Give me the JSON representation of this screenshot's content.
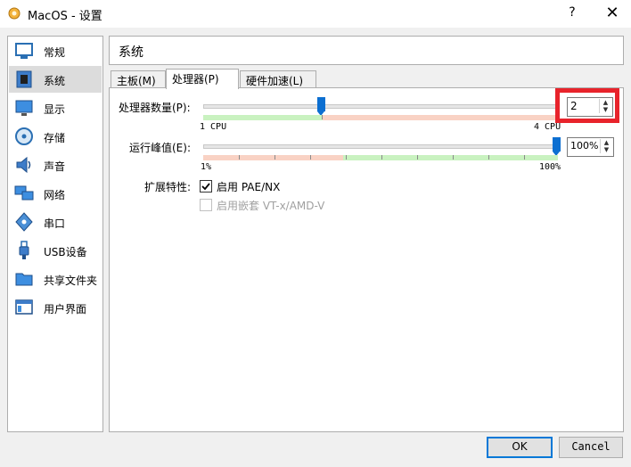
{
  "window": {
    "title": "MacOS - 设置",
    "help_label": "?",
    "close_label": "✕"
  },
  "sidebar": {
    "items": [
      {
        "label": "常规",
        "icon": "general-icon",
        "selected": false
      },
      {
        "label": "系统",
        "icon": "system-icon",
        "selected": true
      },
      {
        "label": "显示",
        "icon": "display-icon",
        "selected": false
      },
      {
        "label": "存储",
        "icon": "storage-icon",
        "selected": false
      },
      {
        "label": "声音",
        "icon": "audio-icon",
        "selected": false
      },
      {
        "label": "网络",
        "icon": "network-icon",
        "selected": false
      },
      {
        "label": "串口",
        "icon": "serial-port-icon",
        "selected": false
      },
      {
        "label": "USB设备",
        "icon": "usb-icon",
        "selected": false
      },
      {
        "label": "共享文件夹",
        "icon": "shared-folder-icon",
        "selected": false
      },
      {
        "label": "用户界面",
        "icon": "user-interface-icon",
        "selected": false
      }
    ]
  },
  "section": {
    "title": "系统"
  },
  "tabs": [
    {
      "label": "主板(M)",
      "active": false
    },
    {
      "label": "处理器(P)",
      "active": true
    },
    {
      "label": "硬件加速(L)",
      "active": false
    }
  ],
  "processor": {
    "cpu_count": {
      "label": "处理器数量(P):",
      "value": "2",
      "min_label": "1 CPU",
      "max_label": "4 CPU",
      "min": 1,
      "max": 4,
      "current": 2
    },
    "execution_cap": {
      "label": "运行峰值(E):",
      "value": "100%",
      "min_label": "1%",
      "max_label": "100%",
      "min": 1,
      "max": 100,
      "current": 100
    },
    "extended_features": {
      "label": "扩展特性:",
      "pae_nx": {
        "label": "启用 PAE/NX",
        "checked": true,
        "enabled": true
      },
      "nested_vtx": {
        "label": "启用嵌套 VT-x/AMD-V",
        "checked": false,
        "enabled": false
      }
    }
  },
  "buttons": {
    "ok": "OK",
    "cancel": "Cancel"
  },
  "colors": {
    "accent": "#0c6fd1",
    "highlight": "#e8232b",
    "safe_range": "#c9f2c0",
    "warn_range": "#f9d2c4"
  }
}
